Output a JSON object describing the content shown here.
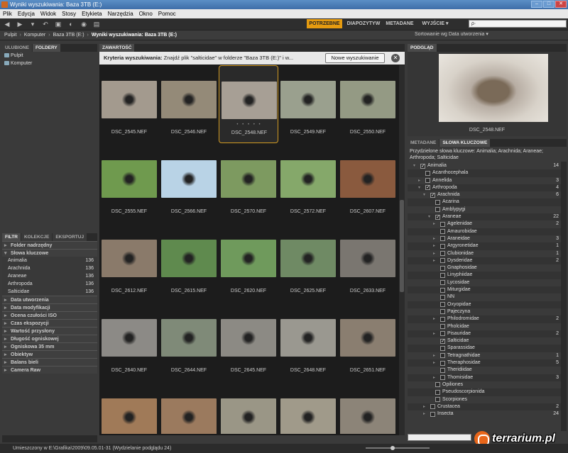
{
  "window": {
    "title": "Wyniki wyszukiwania: Baza 3TB (E:)"
  },
  "menu": [
    "Plik",
    "Edycja",
    "Widok",
    "Stosy",
    "Etykieta",
    "Narzędzia",
    "Okno",
    "Pomoc"
  ],
  "workspaces": {
    "active": "POTRZEBNE",
    "items": [
      "DIAPOZYTYW",
      "METADANE",
      "WYJŚCIE ▾"
    ]
  },
  "search": {
    "placeholder": "ρ·"
  },
  "path": {
    "items": [
      "Pulpit",
      "Komputer",
      "Baza 3TB (E:)"
    ],
    "current": "Wyniki wyszukiwania: Baza 3TB (E:)"
  },
  "sort": {
    "label": "Sortowanie wg Data utworzenia ▾"
  },
  "left_top": {
    "tabs": [
      "ULUBIONE",
      "FOLDERY"
    ],
    "items": [
      "Pulpit",
      "Komputer"
    ]
  },
  "left_bottom": {
    "tabs": [
      "FILTR",
      "KOLEKCJE",
      "EKSPORTUJ"
    ],
    "folder_header": "Folder nadrzędny",
    "keywords_header": "Słowa kluczowe",
    "keywords": [
      {
        "label": "Animalia",
        "count": "136"
      },
      {
        "label": "Arachnida",
        "count": "136"
      },
      {
        "label": "Araneae",
        "count": "136"
      },
      {
        "label": "Arthropoda",
        "count": "136"
      },
      {
        "label": "Salticidae",
        "count": "136"
      }
    ],
    "filters": [
      "Data utworzenia",
      "Data modyfikacji",
      "Ocena czułości ISO",
      "Czas ekspozycji",
      "Wartość przysłony",
      "Długość ogniskowej",
      "Ogniskowa 35 mm",
      "Obiektyw",
      "Balans bieli",
      "Camera Raw"
    ]
  },
  "content": {
    "tab": "ZAWARTOŚĆ",
    "criteria_label": "Kryteria wyszukiwania:",
    "criteria_text": "Znajdź plik \"salticidae\" w folderze \"Baza 3TB (E:)\" i w...",
    "new_search": "Nowe wyszukiwanie",
    "close": "✕",
    "thumbs": [
      {
        "name": "DSC_2545.NEF",
        "tone": "#a39a8e"
      },
      {
        "name": "DSC_2546.NEF",
        "tone": "#948a78"
      },
      {
        "name": "DSC_2548.NEF",
        "tone": "#a79f95"
      },
      {
        "name": "DSC_2549.NEF",
        "tone": "#9aa08e"
      },
      {
        "name": "DSC_2550.NEF",
        "tone": "#949a84"
      },
      {
        "name": "DSC_2555.NEF",
        "tone": "#6f9a4e"
      },
      {
        "name": "DSC_2566.NEF",
        "tone": "#b9d3e6"
      },
      {
        "name": "DSC_2570.NEF",
        "tone": "#7d9a60"
      },
      {
        "name": "DSC_2572.NEF",
        "tone": "#85a86a"
      },
      {
        "name": "DSC_2607.NEF",
        "tone": "#8a5a3e"
      },
      {
        "name": "DSC_2612.NEF",
        "tone": "#8a7a6a"
      },
      {
        "name": "DSC_2615.NEF",
        "tone": "#5f8a4e"
      },
      {
        "name": "DSC_2620.NEF",
        "tone": "#6f9a5c"
      },
      {
        "name": "DSC_2625.NEF",
        "tone": "#6f8a64"
      },
      {
        "name": "DSC_2633.NEF",
        "tone": "#7a7670"
      },
      {
        "name": "DSC_2640.NEF",
        "tone": "#8c8a86"
      },
      {
        "name": "DSC_2644.NEF",
        "tone": "#7f8a78"
      },
      {
        "name": "DSC_2645.NEF",
        "tone": "#8c8a84"
      },
      {
        "name": "DSC_2648.NEF",
        "tone": "#9a9890"
      },
      {
        "name": "DSC_2651.NEF",
        "tone": "#8a7e70"
      },
      {
        "name": "",
        "tone": "#a07a58"
      },
      {
        "name": "",
        "tone": "#9b7a5e"
      },
      {
        "name": "",
        "tone": "#9a9686"
      },
      {
        "name": "",
        "tone": "#a09a8a"
      },
      {
        "name": "",
        "tone": "#8c8478"
      }
    ]
  },
  "preview": {
    "tab": "PODGLĄD",
    "caption": "DSC_2548.NEF"
  },
  "metadata": {
    "tabs": [
      "METADANE",
      "SŁOWA KLUCZOWE"
    ],
    "assigned": "Przydzielone słowa kluczowe: Animalia; Arachnida; Araneae; Arthropoda; Salticidae",
    "tree": [
      {
        "label": "Animalia",
        "level": 0,
        "arrow": "▾",
        "checked": true,
        "count": "14"
      },
      {
        "label": "Acanthocephala",
        "level": 1,
        "arrow": "",
        "checked": false,
        "count": ""
      },
      {
        "label": "Annelida",
        "level": 1,
        "arrow": "▸",
        "checked": false,
        "count": "3"
      },
      {
        "label": "Arthropoda",
        "level": 1,
        "arrow": "▾",
        "checked": true,
        "count": "4"
      },
      {
        "label": "Arachnida",
        "level": 2,
        "arrow": "▾",
        "checked": true,
        "count": "6"
      },
      {
        "label": "Acarina",
        "level": 3,
        "arrow": "",
        "checked": false,
        "count": ""
      },
      {
        "label": "Amblypygi",
        "level": 3,
        "arrow": "",
        "checked": false,
        "count": ""
      },
      {
        "label": "Araneae",
        "level": 3,
        "arrow": "▾",
        "checked": true,
        "count": "22"
      },
      {
        "label": "Agelenidae",
        "level": 4,
        "arrow": "▸",
        "checked": false,
        "count": "2"
      },
      {
        "label": "Amaurobidae",
        "level": 4,
        "arrow": "",
        "checked": false,
        "count": ""
      },
      {
        "label": "Araneidae",
        "level": 4,
        "arrow": "▸",
        "checked": false,
        "count": "3"
      },
      {
        "label": "Argyronetidae",
        "level": 4,
        "arrow": "▸",
        "checked": false,
        "count": "1"
      },
      {
        "label": "Clubionidae",
        "level": 4,
        "arrow": "▸",
        "checked": false,
        "count": "1"
      },
      {
        "label": "Dysderidae",
        "level": 4,
        "arrow": "▸",
        "checked": false,
        "count": "2"
      },
      {
        "label": "Gnaphosidae",
        "level": 4,
        "arrow": "",
        "checked": false,
        "count": ""
      },
      {
        "label": "Linyphiidae",
        "level": 4,
        "arrow": "",
        "checked": false,
        "count": ""
      },
      {
        "label": "Lycosidae",
        "level": 4,
        "arrow": "",
        "checked": false,
        "count": ""
      },
      {
        "label": "Miturgidae",
        "level": 4,
        "arrow": "",
        "checked": false,
        "count": ""
      },
      {
        "label": "NN",
        "level": 4,
        "arrow": "",
        "checked": false,
        "count": ""
      },
      {
        "label": "Oxyopidae",
        "level": 4,
        "arrow": "",
        "checked": false,
        "count": ""
      },
      {
        "label": "Pajeczyna",
        "level": 4,
        "arrow": "",
        "checked": false,
        "count": ""
      },
      {
        "label": "Philodromidae",
        "level": 4,
        "arrow": "▸",
        "checked": false,
        "count": "2"
      },
      {
        "label": "Pholcidae",
        "level": 4,
        "arrow": "",
        "checked": false,
        "count": ""
      },
      {
        "label": "Pisauridae",
        "level": 4,
        "arrow": "▸",
        "checked": false,
        "count": "2"
      },
      {
        "label": "Salticidae",
        "level": 4,
        "arrow": "",
        "checked": true,
        "count": ""
      },
      {
        "label": "Sparassidae",
        "level": 4,
        "arrow": "",
        "checked": false,
        "count": ""
      },
      {
        "label": "Tetragnathidae",
        "level": 4,
        "arrow": "▸",
        "checked": false,
        "count": "1"
      },
      {
        "label": "Theraphosidae",
        "level": 4,
        "arrow": "▸",
        "checked": false,
        "count": "5"
      },
      {
        "label": "Theridiidae",
        "level": 4,
        "arrow": "",
        "checked": false,
        "count": ""
      },
      {
        "label": "Thomisidae",
        "level": 4,
        "arrow": "▸",
        "checked": false,
        "count": "3"
      },
      {
        "label": "Opiliones",
        "level": 3,
        "arrow": "",
        "checked": false,
        "count": ""
      },
      {
        "label": "Pseudoscorpionida",
        "level": 3,
        "arrow": "",
        "checked": false,
        "count": ""
      },
      {
        "label": "Scorpiones",
        "level": 3,
        "arrow": "",
        "checked": false,
        "count": ""
      },
      {
        "label": "Crustacea",
        "level": 2,
        "arrow": "▸",
        "checked": false,
        "count": "2"
      },
      {
        "label": "Insecta",
        "level": 2,
        "arrow": "▸",
        "checked": false,
        "count": "24"
      }
    ]
  },
  "status": {
    "text": "Umieszczony w E:\\Grafika\\2009\\09.05.01-31 (Wydzielanie podglądu 24)"
  },
  "zoom": {
    "level": 0.42
  },
  "logo": {
    "text": "terrarium.pl"
  }
}
